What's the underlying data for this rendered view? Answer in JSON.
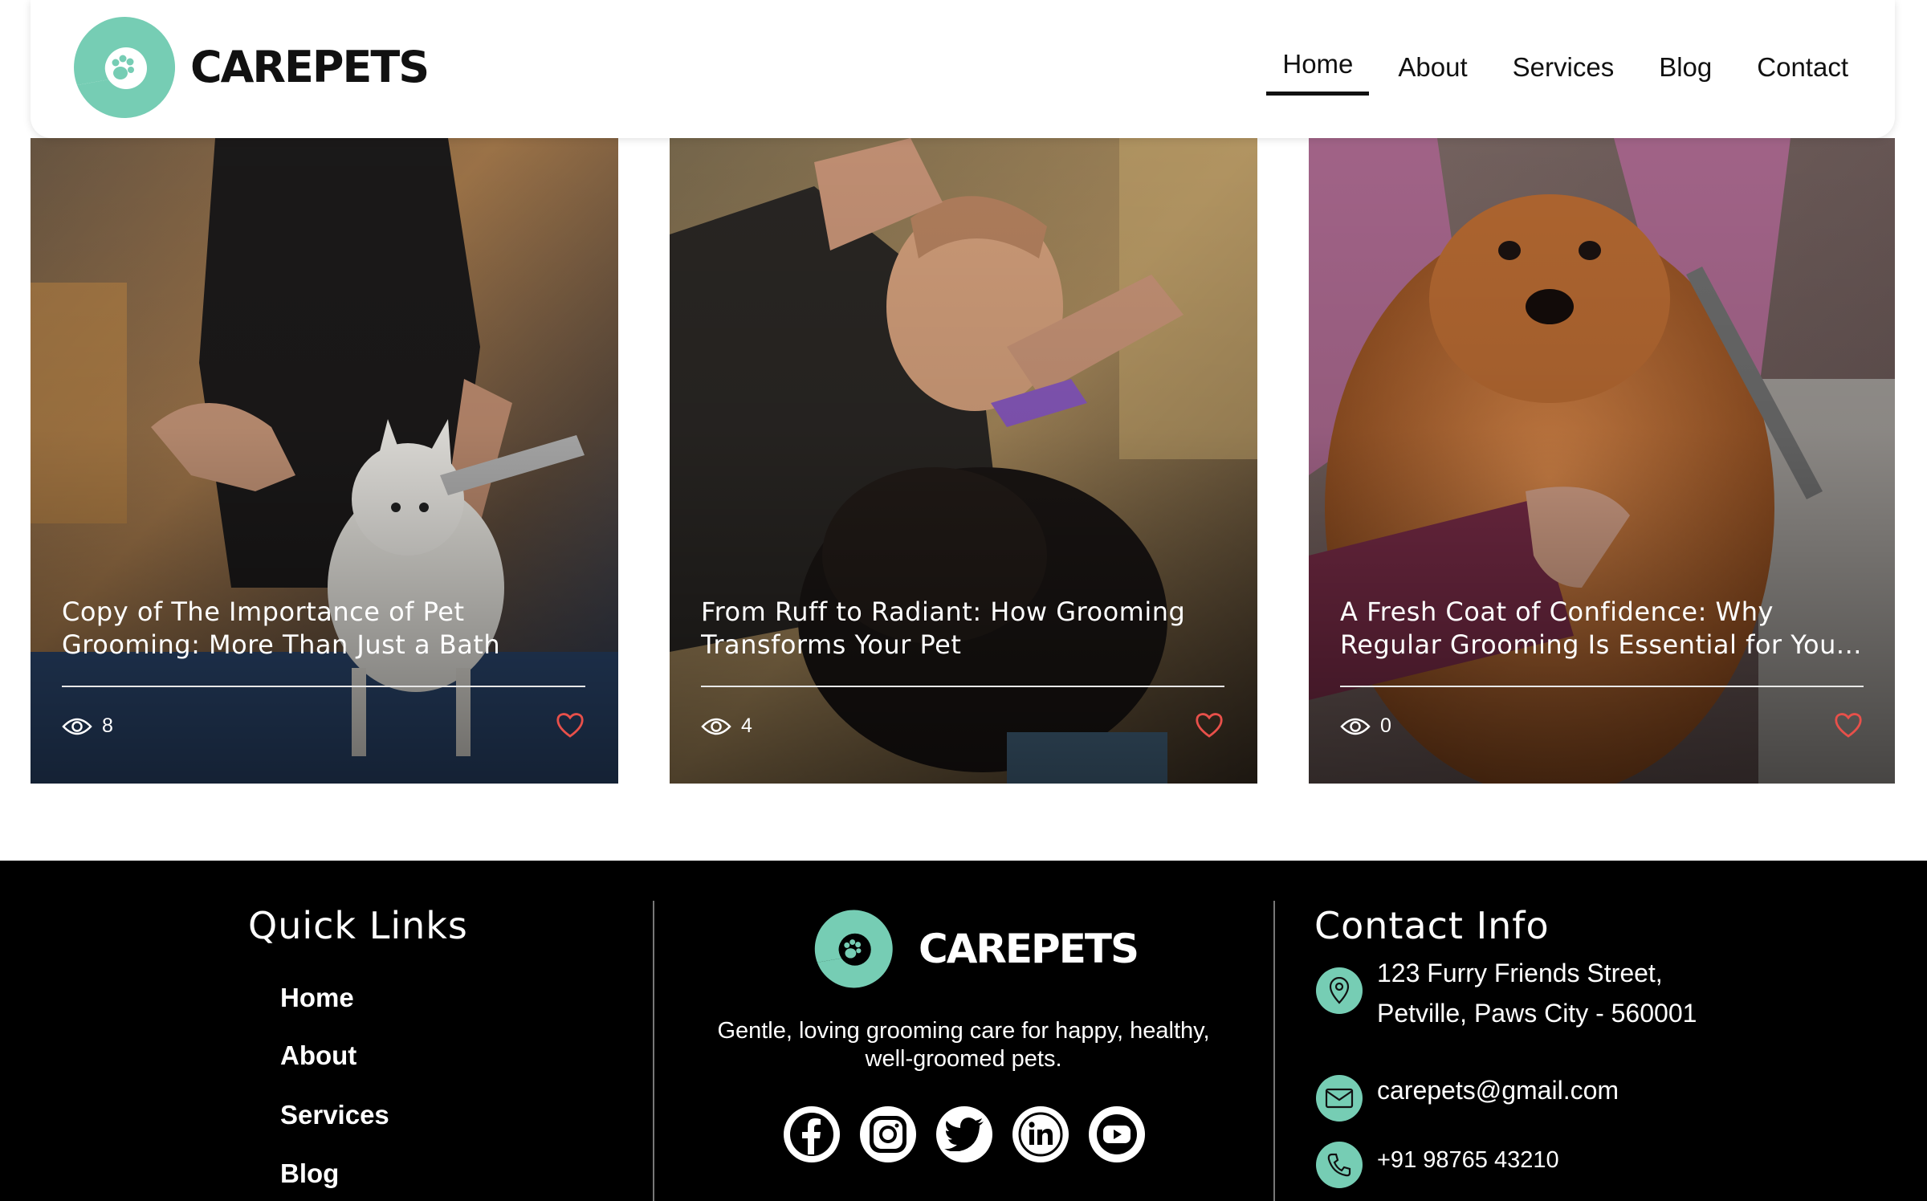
{
  "brand": {
    "name": "CAREPETS",
    "accent": "#76cdb4"
  },
  "nav": {
    "items": [
      {
        "label": "Home",
        "active": true
      },
      {
        "label": "About"
      },
      {
        "label": "Services"
      },
      {
        "label": "Blog"
      },
      {
        "label": "Contact"
      }
    ]
  },
  "posts": [
    {
      "title_line1": "Copy of The Importance of Pet",
      "title_line2": "Grooming: More Than Just a Bath",
      "views": "8",
      "image": "groomer combing a white pomeranian"
    },
    {
      "title_line1": "From Ruff to Radiant: How Grooming",
      "title_line2": "Transforms Your Pet",
      "views": "4",
      "image": "groomer trimming a black dog with scissors"
    },
    {
      "title_line1": "A Fresh Coat of Confidence: Why",
      "title_line2": "Regular Grooming Is Essential for You...",
      "views": "0",
      "image": "pomeranian wrapped in pink towel being combed"
    }
  ],
  "footer": {
    "quick_links": {
      "title": "Quick Links",
      "items": [
        "Home",
        "About",
        "Services",
        "Blog"
      ]
    },
    "brand_name": "CAREPETS",
    "tagline_line1": "Gentle, loving grooming care for happy, healthy,",
    "tagline_line2": "well-groomed pets.",
    "socials": [
      "facebook-icon",
      "instagram-icon",
      "twitter-icon",
      "linkedin-icon",
      "youtube-icon"
    ],
    "contact": {
      "title": "Contact Info",
      "address_line1": "123 Furry Friends Street,",
      "address_line2": "Petville, Paws City - 560001",
      "email": "carepets@gmail.com",
      "phone": "+91 98765 43210"
    }
  }
}
